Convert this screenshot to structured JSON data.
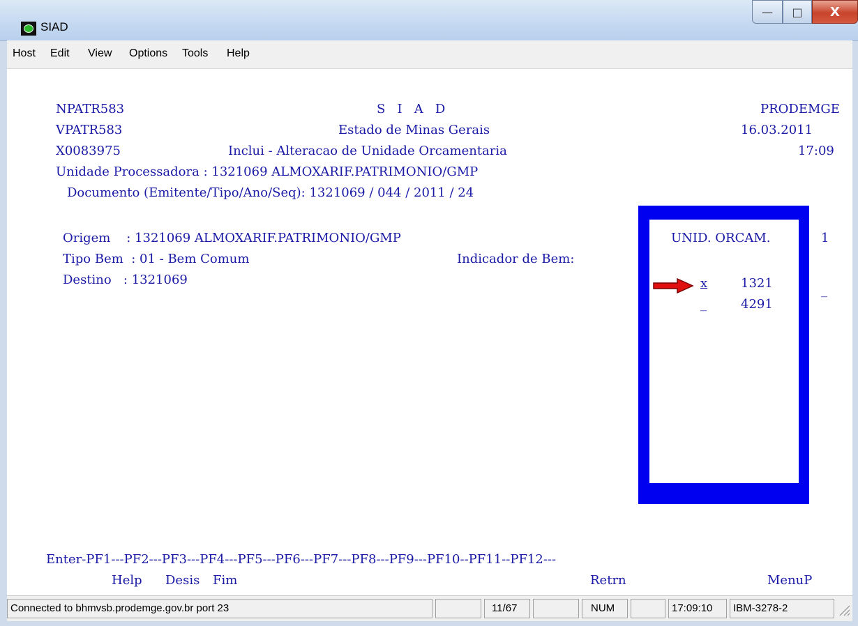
{
  "window": {
    "title": "SIAD",
    "buttons": {
      "minimize": "—",
      "maximize": "□",
      "close": "X"
    }
  },
  "menu": [
    "Host",
    "Edit",
    "View",
    "Options",
    "Tools",
    "Help"
  ],
  "screen": {
    "lines": {
      "l1_program": "NPATR583",
      "l1_title": "S   I   A   D",
      "l1_org": "PRODEMGE",
      "l2_program": "VPATR583",
      "l2_title": "Estado de Minas Gerais",
      "l2_date": "16.03.2011",
      "l3_user": "X0083975",
      "l3_title": "Inclui - Alteracao de Unidade Orcamentaria",
      "l3_time": "17:09",
      "l4": "Unidade Processadora : 1321069 ALMOXARIF.PATRIMONIO/GMP",
      "l5": "Documento (Emitente/Tipo/Ano/Seq): 1321069 / 044 / 2011 / 24",
      "origem": "Origem    : 1321069 ALMOXARIF.PATRIMONIO/GMP",
      "tipo_bem": "Tipo Bem  : 01 - Bem Comum",
      "indicador": "Indicador de Bem:",
      "destino": "Destino   : 1321069",
      "right_value": "1",
      "right_field": "_"
    },
    "popup": {
      "header": "UNID. ORCAM.",
      "items": [
        {
          "select": "x",
          "value": "1321"
        },
        {
          "select": "_",
          "value": "4291"
        }
      ]
    },
    "pf_keys": "Enter-PF1---PF2---PF3---PF4---PF5---PF6---PF7---PF8---PF9---PF10--PF11--PF12---",
    "pf_labels": {
      "pf1": "Help",
      "pf2": "Desis",
      "pf3": "Fim",
      "pf9": "Retrn",
      "pf12": "MenuP"
    }
  },
  "status": {
    "connection": "Connected to bhmvsb.prodemge.gov.br port 23",
    "cursor": "11/67",
    "num": "NUM",
    "clock": "17:09:10",
    "terminal_type": "IBM-3278-2"
  },
  "colors": {
    "terminal_text": "#1a1aa6",
    "popup_border": "#0000f0",
    "arrow": "#e01010"
  }
}
